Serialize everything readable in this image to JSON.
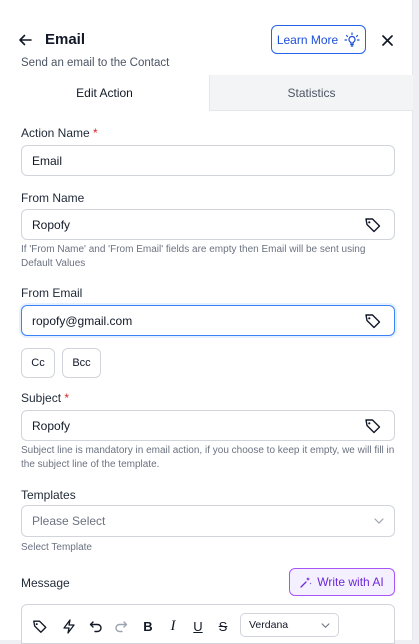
{
  "header": {
    "title": "Email",
    "subtitle": "Send an email to the Contact",
    "learn_more_label": "Learn More"
  },
  "tabs": [
    {
      "label": "Edit Action",
      "active": true
    },
    {
      "label": "Statistics",
      "active": false
    }
  ],
  "form": {
    "action_name": {
      "label": "Action Name",
      "required_mark": "*",
      "value": "Email"
    },
    "from_name": {
      "label": "From Name",
      "value": "Ropofy",
      "hint": "If 'From Name' and 'From Email' fields are empty then Email will be sent using Default Values"
    },
    "from_email": {
      "label": "From Email",
      "value": "ropofy@gmail.com"
    },
    "cc_label": "Cc",
    "bcc_label": "Bcc",
    "subject": {
      "label": "Subject",
      "required_mark": "*",
      "value": "Ropofy",
      "hint": "Subject line is mandatory in email action, if you choose to keep it empty, we will fill in the subject line of the template."
    },
    "templates": {
      "label": "Templates",
      "placeholder": "Please Select",
      "hint": "Select Template"
    },
    "message": {
      "label": "Message",
      "write_ai_label": "Write with AI",
      "font_value": "Verdana"
    }
  },
  "colors": {
    "accent": "#2563eb",
    "ai_accent": "#7c3aed",
    "required": "#dc2626"
  }
}
